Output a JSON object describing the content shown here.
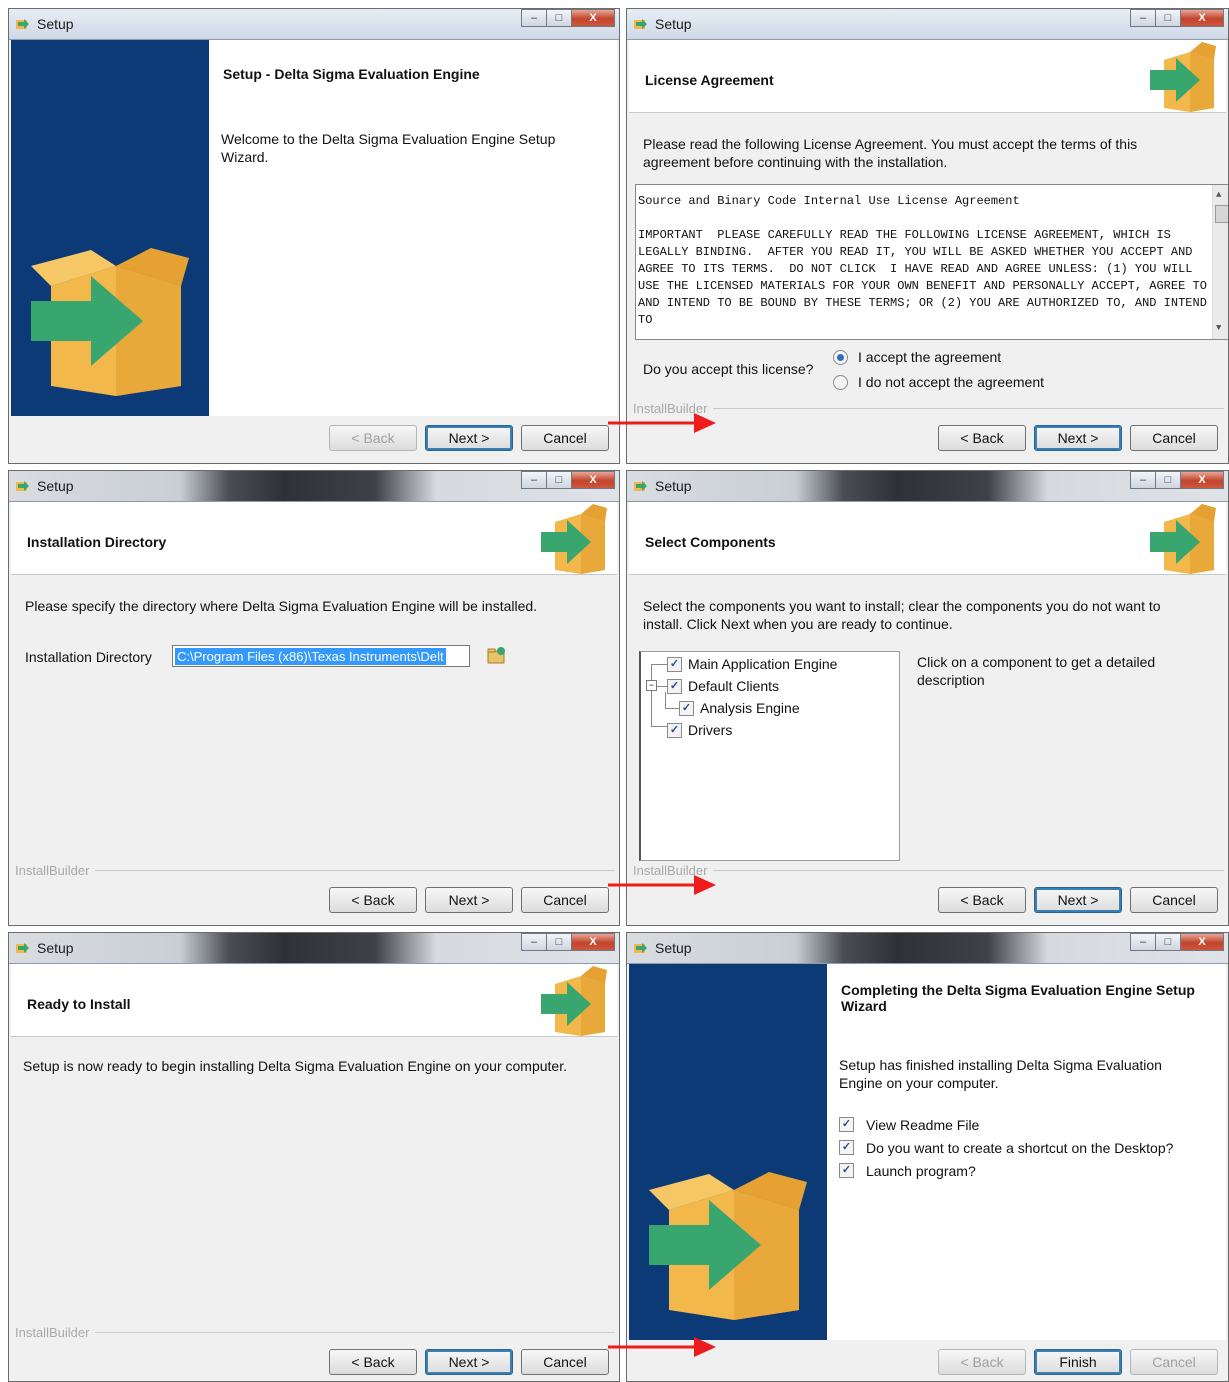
{
  "common": {
    "window_title": "Setup",
    "installbuilder": "InstallBuilder",
    "back": "< Back",
    "next": "Next >",
    "cancel": "Cancel",
    "finish": "Finish",
    "minimize": "–",
    "maximize": "□",
    "close": "X"
  },
  "welcome": {
    "title": "Setup - Delta Sigma Evaluation Engine",
    "text": "Welcome to the Delta Sigma Evaluation Engine Setup Wizard."
  },
  "license": {
    "title": "License Agreement",
    "description": "Please read the following License Agreement. You must accept the terms of this agreement before continuing with the installation.",
    "text": "Source and Binary Code Internal Use License Agreement\n\nIMPORTANT  PLEASE CAREFULLY READ THE FOLLOWING LICENSE AGREEMENT, WHICH IS LEGALLY BINDING.  AFTER YOU READ IT, YOU WILL BE ASKED WHETHER YOU ACCEPT AND AGREE TO ITS TERMS.  DO NOT CLICK  I HAVE READ AND AGREE UNLESS: (1) YOU WILL USE THE LICENSED MATERIALS FOR YOUR OWN BENEFIT AND PERSONALLY ACCEPT, AGREE TO AND INTEND TO BE BOUND BY THESE TERMS; OR (2) YOU ARE AUTHORIZED TO, AND INTEND TO",
    "question": "Do you accept this license?",
    "accept": "I accept the agreement",
    "decline": "I do not accept the agreement",
    "selected": "accept"
  },
  "directory": {
    "title": "Installation Directory",
    "description": "Please specify the directory where Delta Sigma Evaluation Engine will be installed.",
    "label": "Installation Directory",
    "value": "C:\\Program Files (x86)\\Texas Instruments\\Delt"
  },
  "components": {
    "title": "Select Components",
    "description": "Select the components you want to install; clear the components you do not want to install. Click Next when you are ready to continue.",
    "items": [
      {
        "label": "Main Application Engine",
        "checked": true
      },
      {
        "label": "Default Clients",
        "checked": true
      },
      {
        "label": "Analysis Engine",
        "checked": true
      },
      {
        "label": "Drivers",
        "checked": true
      }
    ],
    "hint": "Click on a component to get a detailed description"
  },
  "ready": {
    "title": "Ready to Install",
    "description": "Setup is now ready to begin installing Delta Sigma Evaluation Engine on your computer."
  },
  "finish": {
    "title": "Completing the Delta Sigma Evaluation Engine Setup Wizard",
    "text": "Setup has finished installing Delta Sigma Evaluation Engine on your computer.",
    "options": [
      {
        "label": "View Readme File",
        "checked": true
      },
      {
        "label": "Do you want to create a shortcut on the Desktop?",
        "checked": true
      },
      {
        "label": "Launch program?",
        "checked": true
      }
    ]
  },
  "colors": {
    "sidebar": "#0c3a76",
    "arrow": "#ee1c1c",
    "box": "#f2b84b",
    "green_arrow": "#3aa66f"
  }
}
